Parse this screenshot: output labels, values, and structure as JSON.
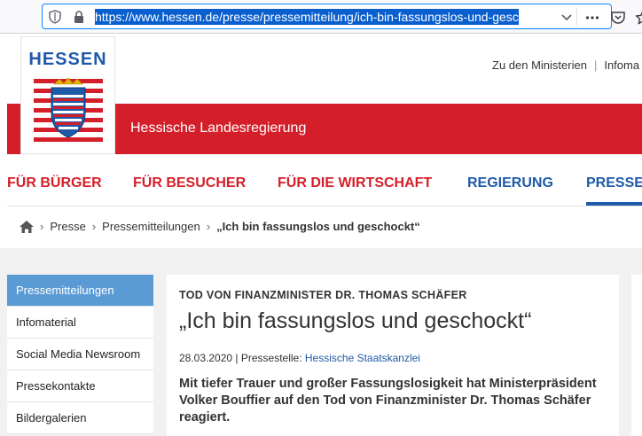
{
  "browser": {
    "url": "https://www.hessen.de/presse/pressemitteilung/ich-bin-fassungslos-und-gesc"
  },
  "header": {
    "logo_text": "HESSEN",
    "top_links": [
      "Zu den Ministerien",
      "Infoma"
    ],
    "banner_title": "Hessische Landesregierung"
  },
  "nav": {
    "items": [
      "FÜR BÜRGER",
      "FÜR BESUCHER",
      "FÜR DIE WIRTSCHAFT",
      "REGIERUNG",
      "PRESSE"
    ]
  },
  "breadcrumb": {
    "items": [
      "Presse",
      "Pressemitteilungen",
      "„Ich bin fassungslos und geschockt“"
    ]
  },
  "sidebar": {
    "items": [
      "Pressemitteilungen",
      "Infomaterial",
      "Social Media Newsroom",
      "Pressekontakte",
      "Bildergalerien"
    ]
  },
  "article": {
    "kicker": "TOD VON FINANZMINISTER DR. THOMAS SCHÄFER",
    "title": "„Ich bin fassungslos und geschockt“",
    "date": "28.03.2020",
    "separator": " | ",
    "source_label": "Pressestelle: ",
    "source_link": "Hessische Staatskanzlei",
    "lead": "Mit tiefer Trauer und großer Fassungslosigkeit hat Ministerpräsident Volker Bouffier auf den Tod von Finanzminister Dr. Thomas Schäfer reagiert."
  },
  "colors": {
    "brand_red": "#d41f2a",
    "brand_blue": "#1f5aa8",
    "sidebar_active": "#5b9bd5"
  }
}
